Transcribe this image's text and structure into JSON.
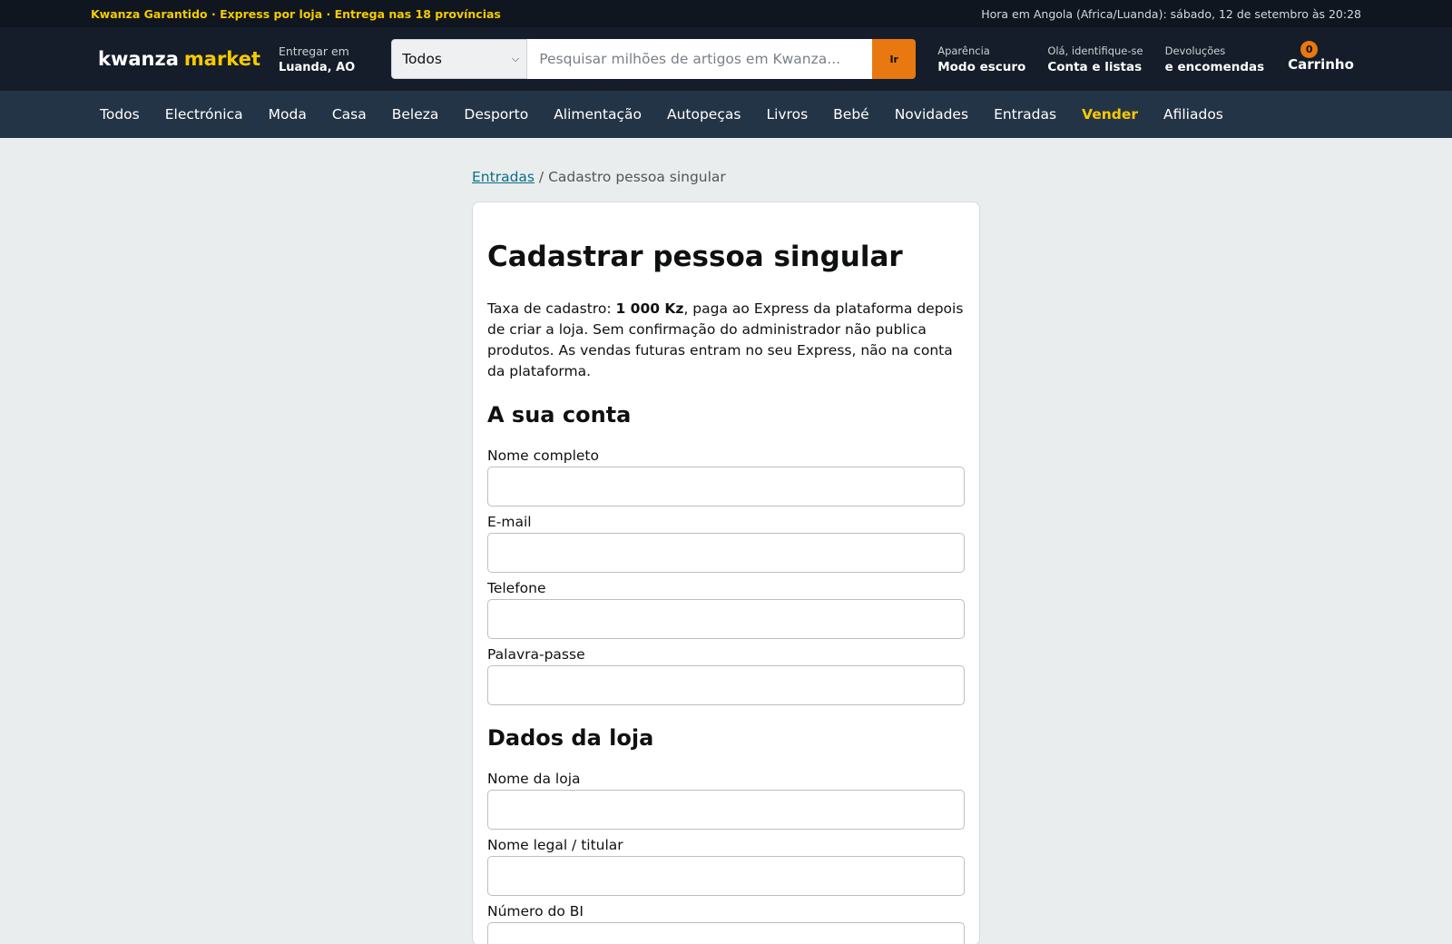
{
  "topstrip": {
    "promo": "Kwanza Garantido · Express por loja · Entrega nas 18 províncias",
    "clock": "Hora em Angola (Africa/Luanda): sábado, 12 de setembro às 20:28"
  },
  "header": {
    "logo_word1": "kwanza",
    "logo_word2": "market",
    "deliver_label": "Entregar em",
    "deliver_value": "Luanda, AO",
    "search_category": "Todos",
    "search_placeholder": "Pesquisar milhões de artigos em Kwanza...",
    "search_button": "Ir",
    "appearance_label": "Aparência",
    "appearance_value": "Modo escuro",
    "account_label": "Olá, identifique-se",
    "account_value": "Conta e listas",
    "orders_label": "Devoluções",
    "orders_value": "e encomendas",
    "cart_count": "0",
    "cart_label": "Carrinho"
  },
  "nav": {
    "items": [
      "Todos",
      "Electrónica",
      "Moda",
      "Casa",
      "Beleza",
      "Desporto",
      "Alimentação",
      "Autopeças",
      "Livros",
      "Bebé",
      "Novidades",
      "Entradas",
      "Vender",
      "Afiliados"
    ]
  },
  "breadcrumb": {
    "link": "Entradas",
    "separator": " / ",
    "current": "Cadastro pessoa singular"
  },
  "form": {
    "title": "Cadastrar pessoa singular",
    "lead_prefix": "Taxa de cadastro: ",
    "lead_fee": "1 000 Kz",
    "lead_suffix": ", paga ao Express da plataforma depois de criar a loja. Sem confirmação do administrador não publica produtos. As vendas futuras entram no seu Express, não na conta da plataforma.",
    "section_account": "A sua conta",
    "full_name_label": "Nome completo",
    "email_label": "E-mail",
    "phone_label": "Telefone",
    "password_label": "Palavra-passe",
    "section_store": "Dados da loja",
    "store_name_label": "Nome da loja",
    "legal_name_label": "Nome legal / titular",
    "bi_number_label": "Número do BI"
  },
  "colors": {
    "accent_yellow": "#f7ca00",
    "accent_orange": "#e8780f",
    "header_bg": "#141d29",
    "nav_bg": "#243447",
    "link": "#0a6f82"
  }
}
